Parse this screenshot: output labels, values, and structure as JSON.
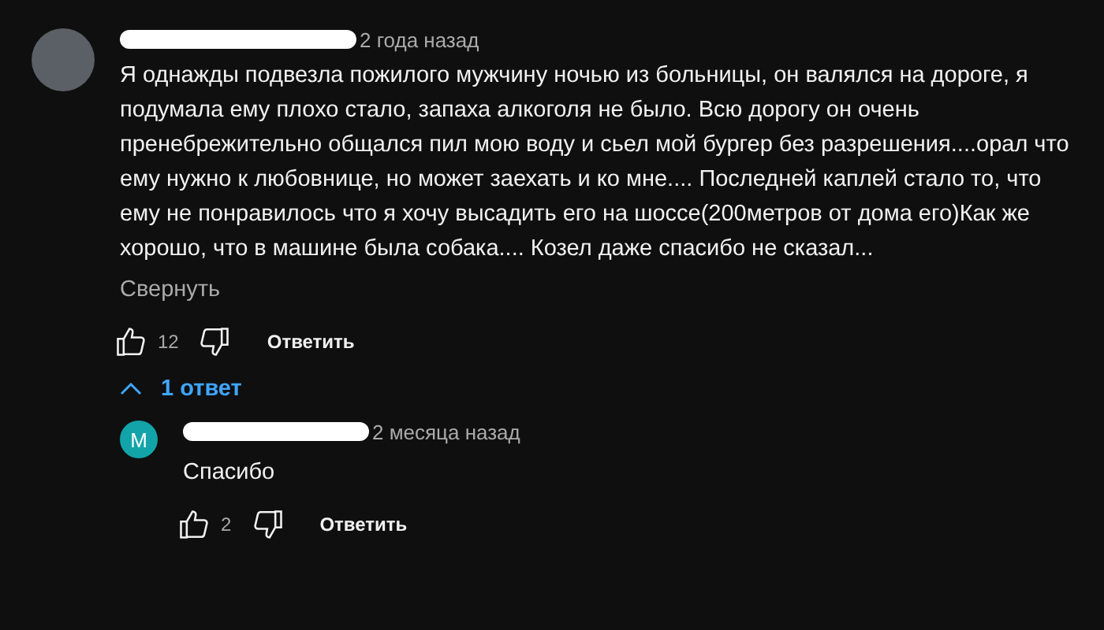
{
  "comment": {
    "time": "2 года назад",
    "text": "Я однажды подвезла пожилого мужчину ночью из больницы, он валялся на дороге, я подумала ему плохо стало, запаха алкоголя не было. Всю дорогу он очень пренебрежительно общался пил мою воду и сьел мой бургер без разрешения....орал что ему нужно к любовнице, но может заехать и ко мне.... Последней каплей стало то, что ему не понравилось что я хочу высадить его на шоссе(200метров от дома его)Как же хорошо, что в машине была собака.... Козел даже спасибо не сказал...",
    "collapse": "Свернуть",
    "likes": "12",
    "reply_button": "Ответить",
    "replies_toggle": {
      "label": "1 ответ",
      "expanded": true
    }
  },
  "replies": [
    {
      "avatar_letter": "M",
      "color": "#12a4a8",
      "time": "2 месяца назад",
      "text": "Спасибо",
      "likes": "2",
      "reply_button": "Ответить"
    }
  ]
}
